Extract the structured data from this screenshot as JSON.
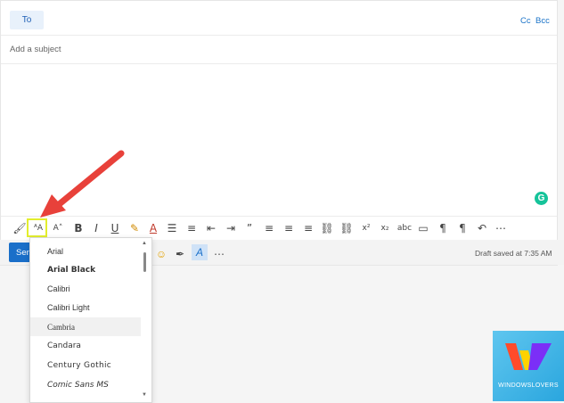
{
  "compose": {
    "to_label": "To",
    "cc_label": "Cc",
    "bcc_label": "Bcc",
    "subject_placeholder": "Add a subject",
    "grammarly_letter": "G"
  },
  "toolbar": {
    "icons": [
      {
        "name": "format-painter-icon",
        "glyph": "🖌"
      },
      {
        "name": "font-icon",
        "glyph": "ᴬA"
      },
      {
        "name": "font-size-icon",
        "glyph": "A˄"
      },
      {
        "name": "bold-icon",
        "glyph": "B"
      },
      {
        "name": "italic-icon",
        "glyph": "I"
      },
      {
        "name": "underline-icon",
        "glyph": "U"
      },
      {
        "name": "highlight-icon",
        "glyph": "✎"
      },
      {
        "name": "font-color-icon",
        "glyph": "A"
      },
      {
        "name": "bullets-icon",
        "glyph": "☰"
      },
      {
        "name": "numbering-icon",
        "glyph": "≡"
      },
      {
        "name": "decrease-indent-icon",
        "glyph": "⇤"
      },
      {
        "name": "increase-indent-icon",
        "glyph": "⇥"
      },
      {
        "name": "quote-icon",
        "glyph": "”"
      },
      {
        "name": "align-left-icon",
        "glyph": "≡"
      },
      {
        "name": "align-center-icon",
        "glyph": "≡"
      },
      {
        "name": "align-right-icon",
        "glyph": "≡"
      },
      {
        "name": "link-icon",
        "glyph": "⛓"
      },
      {
        "name": "unlink-icon",
        "glyph": "⛓"
      },
      {
        "name": "superscript-icon",
        "glyph": "x²"
      },
      {
        "name": "subscript-icon",
        "glyph": "x₂"
      },
      {
        "name": "strikethrough-icon",
        "glyph": "abc"
      },
      {
        "name": "clear-formatting-icon",
        "glyph": "▭"
      },
      {
        "name": "ltr-icon",
        "glyph": "¶"
      },
      {
        "name": "rtl-icon",
        "glyph": "¶"
      },
      {
        "name": "undo-icon",
        "glyph": "↶"
      },
      {
        "name": "more-icon",
        "glyph": "⋯"
      }
    ]
  },
  "action_bar": {
    "send_label": "Send",
    "draft_status": "Draft saved at 7:35 AM",
    "emoji_glyph": "☺",
    "sign_glyph": "✒",
    "editor_glyph": "A",
    "more_glyph": "⋯"
  },
  "font_dropdown": {
    "fonts": [
      "Arial",
      "Arial Black",
      "Calibri",
      "Calibri Light",
      "Cambria",
      "Candara",
      "Century Gothic",
      "Comic Sans MS"
    ],
    "selected": "Cambria"
  },
  "logo": {
    "text": "WINDOWSLOVERS",
    "colors": [
      "#ff4b2b",
      "#ffd200",
      "#7b2ff7"
    ]
  },
  "arrow_color": "#e8413a",
  "highlight_color": "#e3ee2d"
}
